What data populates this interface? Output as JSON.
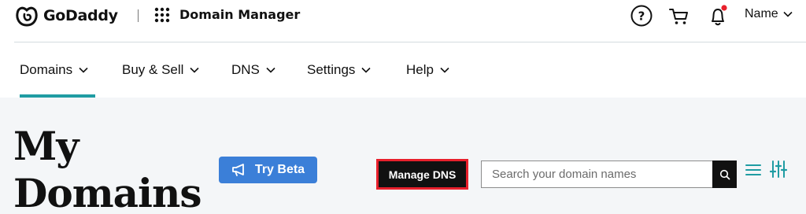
{
  "header": {
    "brand_name": "GoDaddy",
    "app_title": "Domain Manager",
    "user_name": "Name",
    "notification_dot_color": "#e8202c"
  },
  "nav": {
    "items": [
      {
        "label": "Domains",
        "active": true
      },
      {
        "label": "Buy & Sell"
      },
      {
        "label": "DNS"
      },
      {
        "label": "Settings"
      },
      {
        "label": "Help"
      }
    ],
    "active_color": "#1f9ca3"
  },
  "main": {
    "page_title": "My\nDomains",
    "try_beta_label": "Try Beta",
    "manage_dns_label": "Manage DNS",
    "search_placeholder": "Search your domain names"
  },
  "colors": {
    "accent_blue": "#3b7fd8",
    "highlight_red": "#e8202c",
    "content_bg": "#f4f6f8"
  }
}
